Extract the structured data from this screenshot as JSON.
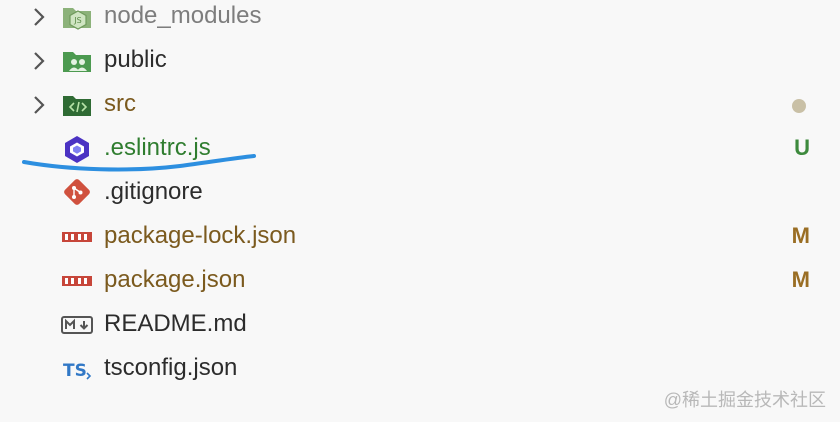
{
  "explorer": {
    "items": [
      {
        "name": "node_modules",
        "type": "folder",
        "icon": "nodejs-folder-icon",
        "color": "#7d7d7d",
        "status": "",
        "status_color": ""
      },
      {
        "name": "public",
        "type": "folder",
        "icon": "public-folder-icon",
        "color": "#2c2c2c",
        "status": "",
        "status_color": ""
      },
      {
        "name": "src",
        "type": "folder",
        "icon": "src-folder-icon",
        "color": "#7b5a1e",
        "status": "dot",
        "status_color": "#c9c0a6"
      },
      {
        "name": ".eslintrc.js",
        "type": "file",
        "icon": "eslint-icon",
        "color": "#2f7d2f",
        "status": "U",
        "status_color": "#3d8a3d"
      },
      {
        "name": ".gitignore",
        "type": "file",
        "icon": "git-icon",
        "color": "#2c2c2c",
        "status": "",
        "status_color": ""
      },
      {
        "name": "package-lock.json",
        "type": "file",
        "icon": "npm-icon",
        "color": "#7b5a1e",
        "status": "M",
        "status_color": "#9a6e24"
      },
      {
        "name": "package.json",
        "type": "file",
        "icon": "npm-icon",
        "color": "#7b5a1e",
        "status": "M",
        "status_color": "#9a6e24"
      },
      {
        "name": "README.md",
        "type": "file",
        "icon": "markdown-icon",
        "color": "#2c2c2c",
        "status": "",
        "status_color": ""
      },
      {
        "name": "tsconfig.json",
        "type": "file",
        "icon": "typescript-icon",
        "color": "#2c2c2c",
        "status": "",
        "status_color": ""
      }
    ]
  },
  "annotation": {
    "color": "#2d8fe0"
  },
  "watermark": {
    "text": "@稀土掘金技术社区"
  }
}
